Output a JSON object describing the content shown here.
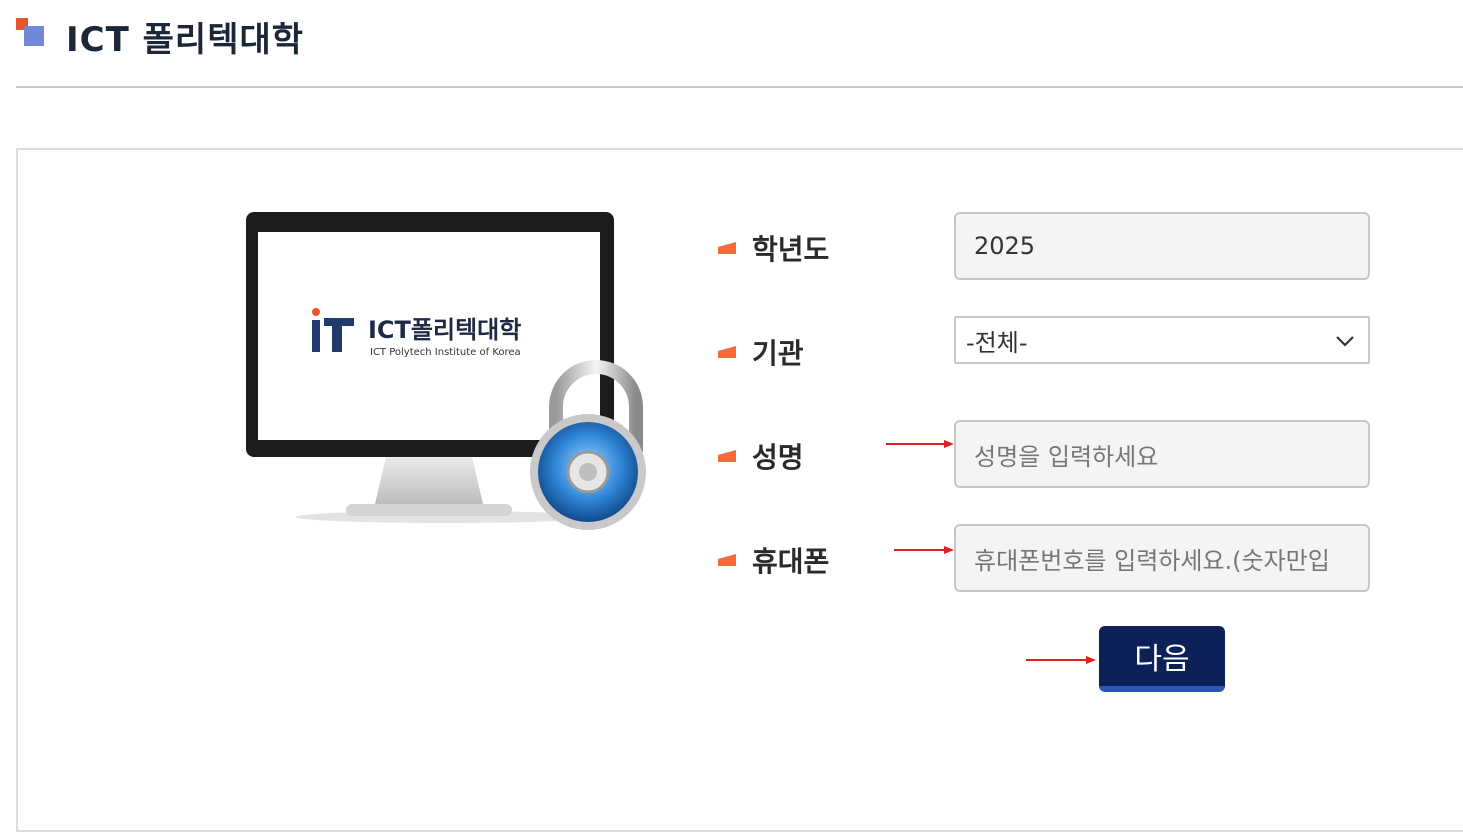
{
  "header": {
    "title": "ICT 폴리텍대학"
  },
  "illustration": {
    "brand_ko": "ICT폴리텍대학",
    "brand_en": "ICT Polytech Institute of Korea"
  },
  "form": {
    "year": {
      "label": "학년도",
      "value": "2025"
    },
    "institution": {
      "label": "기관",
      "selected": "-전체-"
    },
    "name": {
      "label": "성명",
      "placeholder": "성명을 입력하세요"
    },
    "phone": {
      "label": "휴대폰",
      "placeholder": "휴대폰번호를 입력하세요.(숫자만입"
    },
    "next_label": "다음"
  },
  "colors": {
    "accent_orange": "#f26b3a",
    "button_navy": "#0b2158",
    "arrow_red": "#e02020"
  }
}
